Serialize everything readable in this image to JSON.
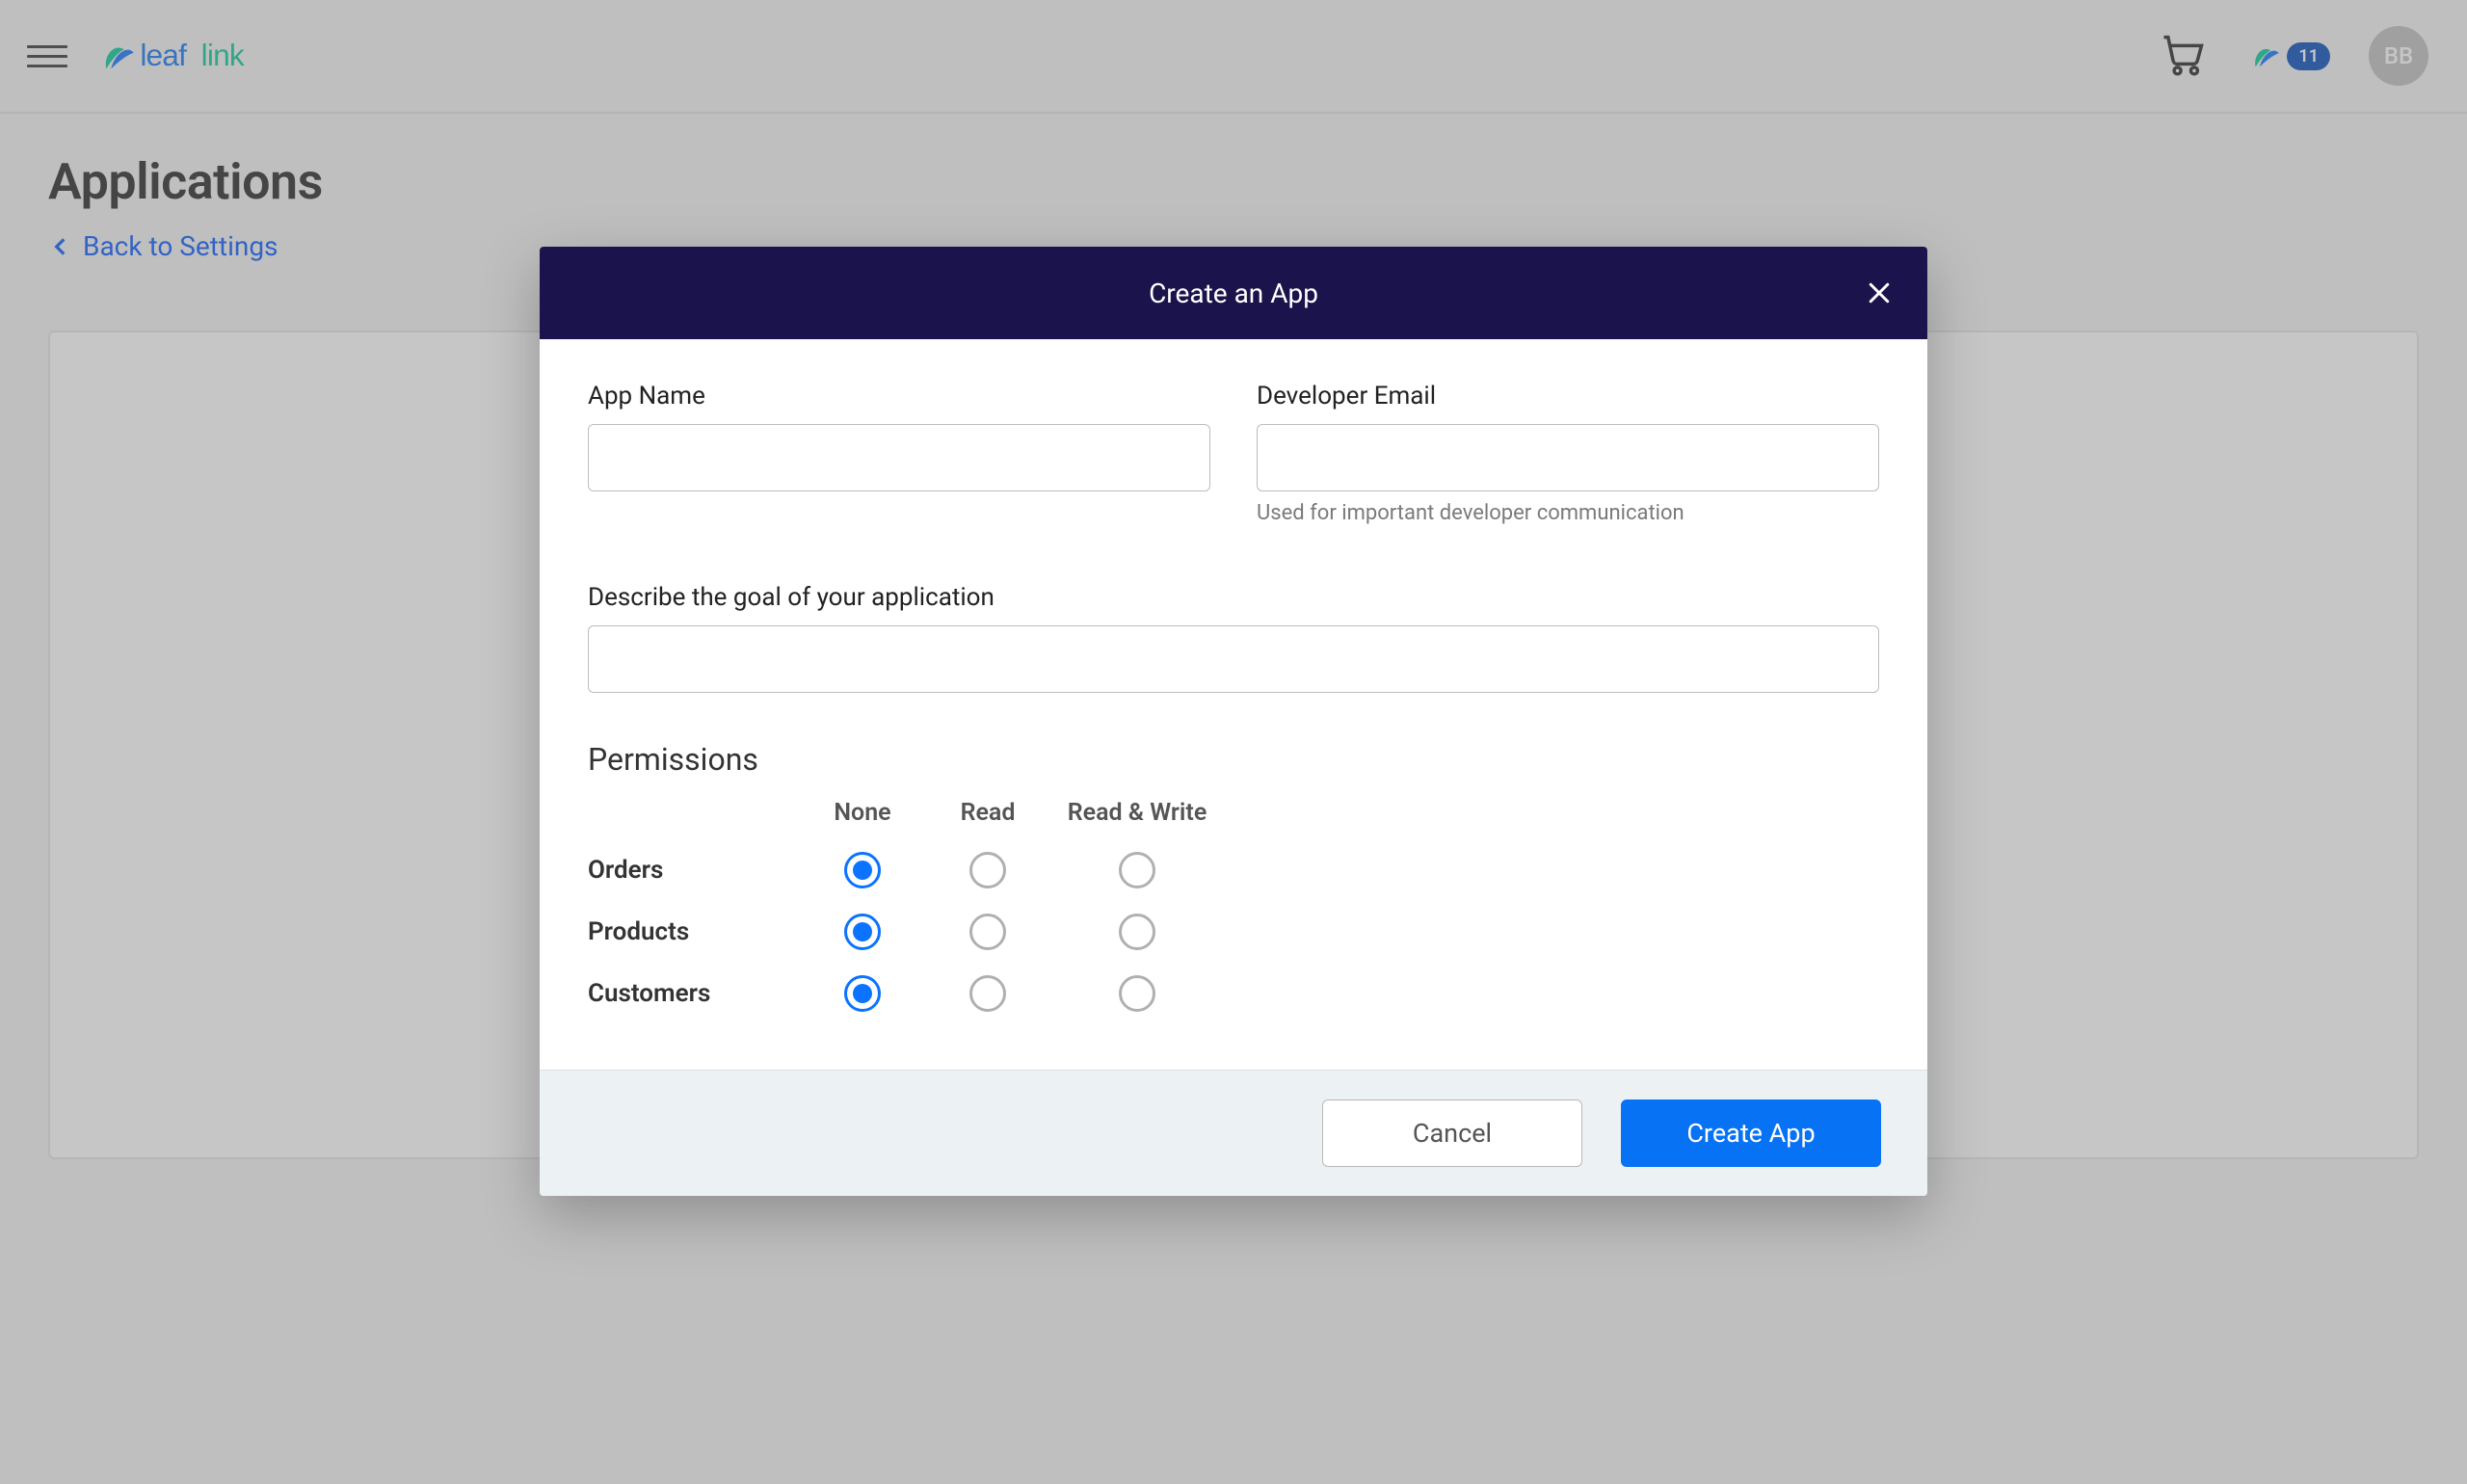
{
  "header": {
    "badge_count": "11",
    "avatar_initials": "BB"
  },
  "page": {
    "title": "Applications",
    "back_link": "Back to Settings"
  },
  "modal": {
    "title": "Create an App",
    "app_name_label": "App Name",
    "developer_email_label": "Developer Email",
    "developer_email_help": "Used for important developer communication",
    "goal_label": "Describe the goal of your application",
    "permissions_title": "Permissions",
    "columns": {
      "none": "None",
      "read": "Read",
      "readwrite": "Read & Write"
    },
    "rows": {
      "orders": "Orders",
      "products": "Products",
      "customers": "Customers"
    },
    "selected": {
      "orders": "none",
      "products": "none",
      "customers": "none"
    },
    "cancel": "Cancel",
    "create": "Create App"
  }
}
